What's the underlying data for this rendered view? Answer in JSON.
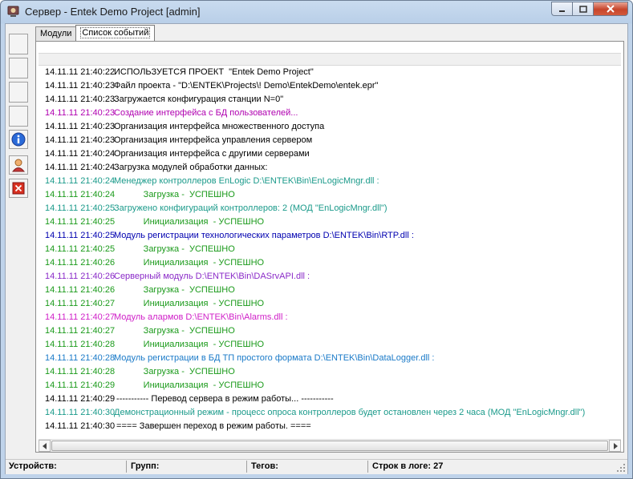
{
  "window": {
    "title": "Сервер - Entek Demo Project [admin]"
  },
  "tabs": [
    {
      "label": "Модули",
      "active": false
    },
    {
      "label": "Список событий",
      "active": true
    }
  ],
  "toolbar": {
    "buttons": [
      {
        "name": "toolbar-button-1",
        "icon": ""
      },
      {
        "name": "toolbar-button-2",
        "icon": ""
      },
      {
        "name": "toolbar-button-3",
        "icon": ""
      },
      {
        "name": "toolbar-button-4",
        "icon": ""
      },
      {
        "name": "info-button",
        "icon": "info-icon"
      },
      {
        "name": "user-button",
        "icon": "user-icon"
      },
      {
        "name": "stop-button",
        "icon": "close-icon"
      }
    ]
  },
  "log": [
    {
      "time": "14.11.11 21:40:22",
      "msg": "ИСПОЛЬЗУЕТСЯ ПРОЕКТ  \"Entek Demo Project\"",
      "color": "#000000"
    },
    {
      "time": "14.11.11 21:40:23",
      "msg": "Файл проекта - \"D:\\ENTEK\\Projects\\! Demo\\EntekDemo\\entek.epr\"",
      "color": "#000000"
    },
    {
      "time": "14.11.11 21:40:23",
      "msg": "Загружается конфигурация станции N=0\"",
      "color": "#000000"
    },
    {
      "time": "14.11.11 21:40:23",
      "msg": "Создание интерфейса с БД пользователей...",
      "color": "#b000b0"
    },
    {
      "time": "14.11.11 21:40:23",
      "msg": "Организация интерфейса множественного доступа",
      "color": "#000000"
    },
    {
      "time": "14.11.11 21:40:23",
      "msg": "Организация интерфейса управления сервером",
      "color": "#000000"
    },
    {
      "time": "14.11.11 21:40:24",
      "msg": "Организация интерфейса с другими серверами",
      "color": "#000000"
    },
    {
      "time": "14.11.11 21:40:24",
      "msg": "Загрузка модулей обработки данных:",
      "color": "#000000"
    },
    {
      "time": "14.11.11 21:40:24",
      "msg": "Менеджер контроллеров EnLogic D:\\ENTEK\\Bin\\EnLogicMngr.dll :",
      "color": "#1a9a8a"
    },
    {
      "time": "14.11.11 21:40:24",
      "msg": "            Загрузка -  УСПЕШНО",
      "color": "#1a9a1a"
    },
    {
      "time": "14.11.11 21:40:25",
      "msg": "Загружено конфигураций контроллеров: 2 (МОД \"EnLogicMngr.dll\")",
      "color": "#1a9a8a"
    },
    {
      "time": "14.11.11 21:40:25",
      "msg": "            Инициализация  - УСПЕШНО",
      "color": "#1a9a1a"
    },
    {
      "time": "14.11.11 21:40:25",
      "msg": "Модуль регистрации технологических параметров D:\\ENTEK\\Bin\\RTP.dll :",
      "color": "#0000b0"
    },
    {
      "time": "14.11.11 21:40:25",
      "msg": "            Загрузка -  УСПЕШНО",
      "color": "#1a9a1a"
    },
    {
      "time": "14.11.11 21:40:26",
      "msg": "            Инициализация  - УСПЕШНО",
      "color": "#1a9a1a"
    },
    {
      "time": "14.11.11 21:40:26",
      "msg": "Серверный модуль D:\\ENTEK\\Bin\\DASrvAPI.dll :",
      "color": "#8a2ac8"
    },
    {
      "time": "14.11.11 21:40:26",
      "msg": "            Загрузка -  УСПЕШНО",
      "color": "#1a9a1a"
    },
    {
      "time": "14.11.11 21:40:27",
      "msg": "            Инициализация  - УСПЕШНО",
      "color": "#1a9a1a"
    },
    {
      "time": "14.11.11 21:40:27",
      "msg": "Модуль алармов D:\\ENTEK\\Bin\\Alarms.dll :",
      "color": "#d020c8"
    },
    {
      "time": "14.11.11 21:40:27",
      "msg": "            Загрузка -  УСПЕШНО",
      "color": "#1a9a1a"
    },
    {
      "time": "14.11.11 21:40:28",
      "msg": "            Инициализация  - УСПЕШНО",
      "color": "#1a9a1a"
    },
    {
      "time": "14.11.11 21:40:28",
      "msg": "Модуль регистрации в БД ТП простого формата D:\\ENTEK\\Bin\\DataLogger.dll :",
      "color": "#1a7ac8"
    },
    {
      "time": "14.11.11 21:40:28",
      "msg": "            Загрузка -  УСПЕШНО",
      "color": "#1a9a1a"
    },
    {
      "time": "14.11.11 21:40:29",
      "msg": "            Инициализация  - УСПЕШНО",
      "color": "#1a9a1a"
    },
    {
      "time": "14.11.11 21:40:29",
      "msg": " ----------- Перевод сервера в режим работы... -----------",
      "color": "#000000"
    },
    {
      "time": "14.11.11 21:40:30",
      "msg": "Демонстрационный режим - процесс опроса контроллеров будет остановлен через 2 часа (МОД \"EnLogicMngr.dll\")",
      "color": "#1a9a8a"
    },
    {
      "time": "14.11.11 21:40:30",
      "msg": " ==== Завершен переход в режим работы. ====",
      "color": "#000000"
    }
  ],
  "status": {
    "devices": "Устройств:",
    "groups": "Групп:",
    "tags": "Тегов:",
    "log_lines": "Строк в логе: 27"
  },
  "colors": {
    "titlebar": "#c9dbef",
    "close": "#c7452b"
  }
}
